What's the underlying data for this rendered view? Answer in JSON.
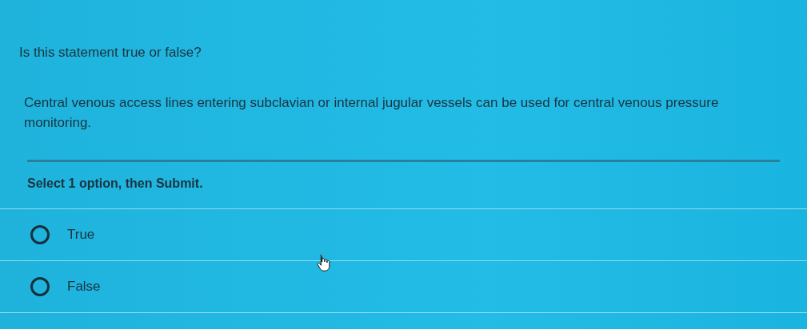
{
  "prompt": "Is this statement true or false?",
  "statement": "Central venous access lines entering subclavian or internal jugular vessels can be used for central venous pressure monitoring.",
  "instruction": "Select 1 option, then Submit.",
  "options": [
    {
      "label": "True",
      "selected": false
    },
    {
      "label": "False",
      "selected": false
    }
  ]
}
